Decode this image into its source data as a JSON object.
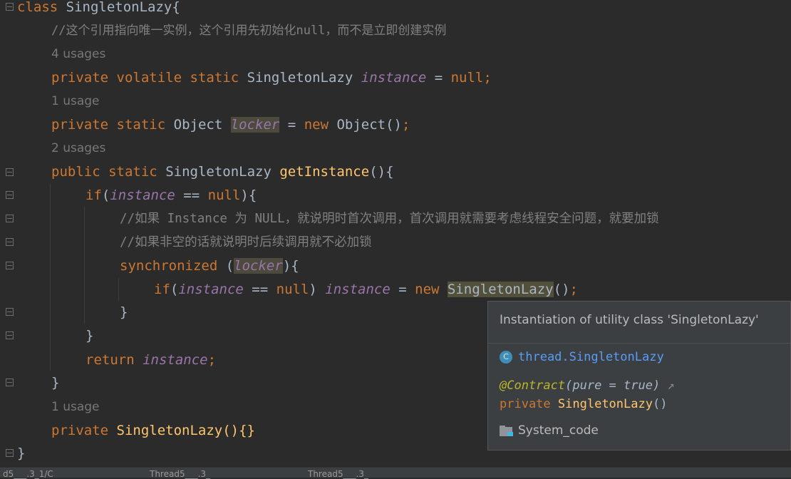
{
  "code": {
    "class_kw": "class",
    "class_name": "SingletonLazy{",
    "comment1": "//这个引用指向唯一实例，这个引用先初始化null，而不是立即创建实例",
    "usages_instance": "4 usages",
    "l_private": "private",
    "l_volatile": "volatile",
    "l_static": "static",
    "l_type_singleton": "SingletonLazy",
    "l_instance": "instance",
    "l_eq_null": " = ",
    "l_null": "null",
    "l_semicolon": ";",
    "usages_locker": "1 usage",
    "l_object": "Object",
    "l_locker": "locker",
    "l_new": "new",
    "l_object_ctor": "Object()",
    "usages_getinstance": "2 usages",
    "l_public": "public",
    "l_getinstance": "getInstance",
    "l_parens_brace": "(){",
    "l_if": "if",
    "l_eqeq": " == ",
    "l_close_brace_paren": "){",
    "comment2": "//如果 Instance 为 NULL，就说明时首次调用，首次调用就需要考虑线程安全问题，就要加锁",
    "comment3": "//如果非空的话就说明时后续调用就不必加锁",
    "l_synchronized": "synchronized",
    "l_assign": " = ",
    "l_ctor_call": "SingletonLazy",
    "l_ctor_parens": "()",
    "l_close": "}",
    "l_return": "return",
    "usages_ctor": "1 usage",
    "l_ctor_decl": "SingletonLazy(){}"
  },
  "tooltip": {
    "title": "Instantiation of utility class 'SingletonLazy'",
    "class_icon": "C",
    "class_ref": "thread.SingletonLazy",
    "annotation": "@Contract",
    "annotation_params": "(pure = true)",
    "external_icon": "↗",
    "sig_private": "private",
    "sig_name": "SingletonLazy",
    "sig_parens": "()",
    "module": "System_code"
  },
  "status": {
    "item1": "d5___.3_1/C",
    "item2": "Thread5___.3_",
    "item3": "Thread5___.3_"
  },
  "colors": {
    "background": "#2b2b2b",
    "keyword": "#cc7832",
    "field": "#9876aa",
    "method": "#ffc66d",
    "comment": "#808080",
    "text": "#a9b7c6",
    "link": "#589df6"
  }
}
